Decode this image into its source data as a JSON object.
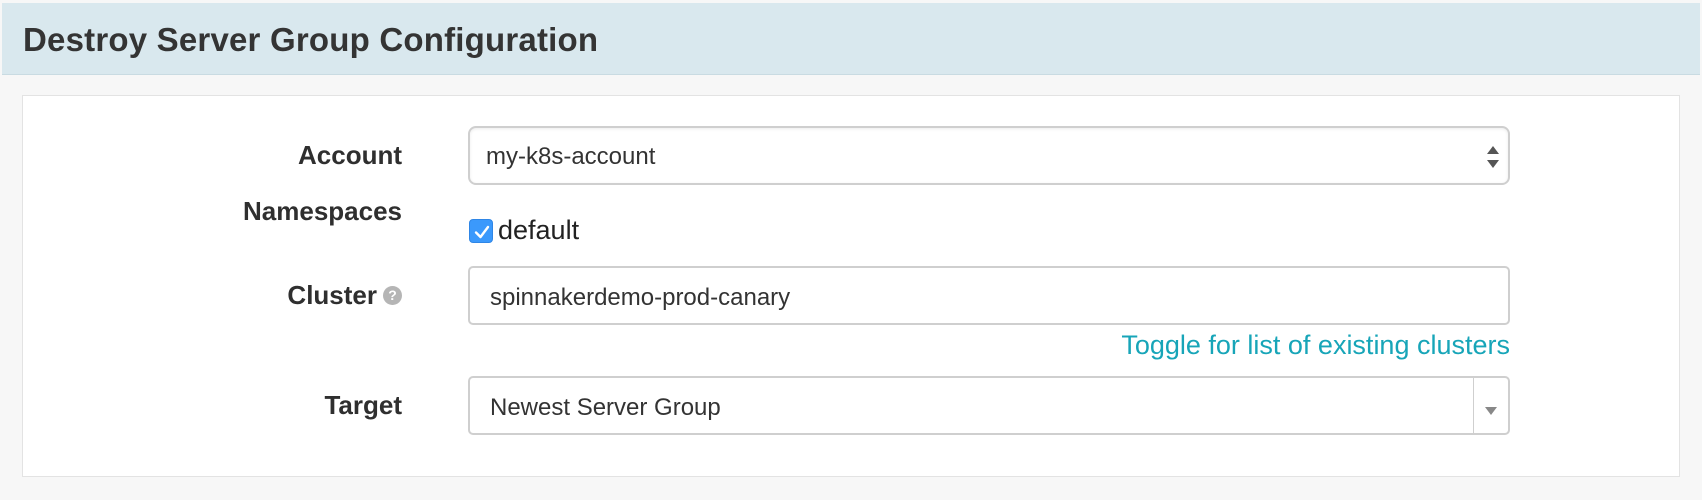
{
  "header": {
    "title": "Destroy Server Group Configuration"
  },
  "form": {
    "account": {
      "label": "Account",
      "value": "my-k8s-account"
    },
    "namespaces": {
      "label": "Namespaces",
      "options": [
        {
          "label": "default",
          "checked": true
        }
      ]
    },
    "cluster": {
      "label": "Cluster",
      "value": "spinnakerdemo-prod-canary",
      "toggle_link": "Toggle for list of existing clusters"
    },
    "target": {
      "label": "Target",
      "value": "Newest Server Group"
    }
  },
  "colors": {
    "header_bg": "#d9e8ee",
    "link": "#17a5b8",
    "checkbox": "#3b99fc"
  }
}
